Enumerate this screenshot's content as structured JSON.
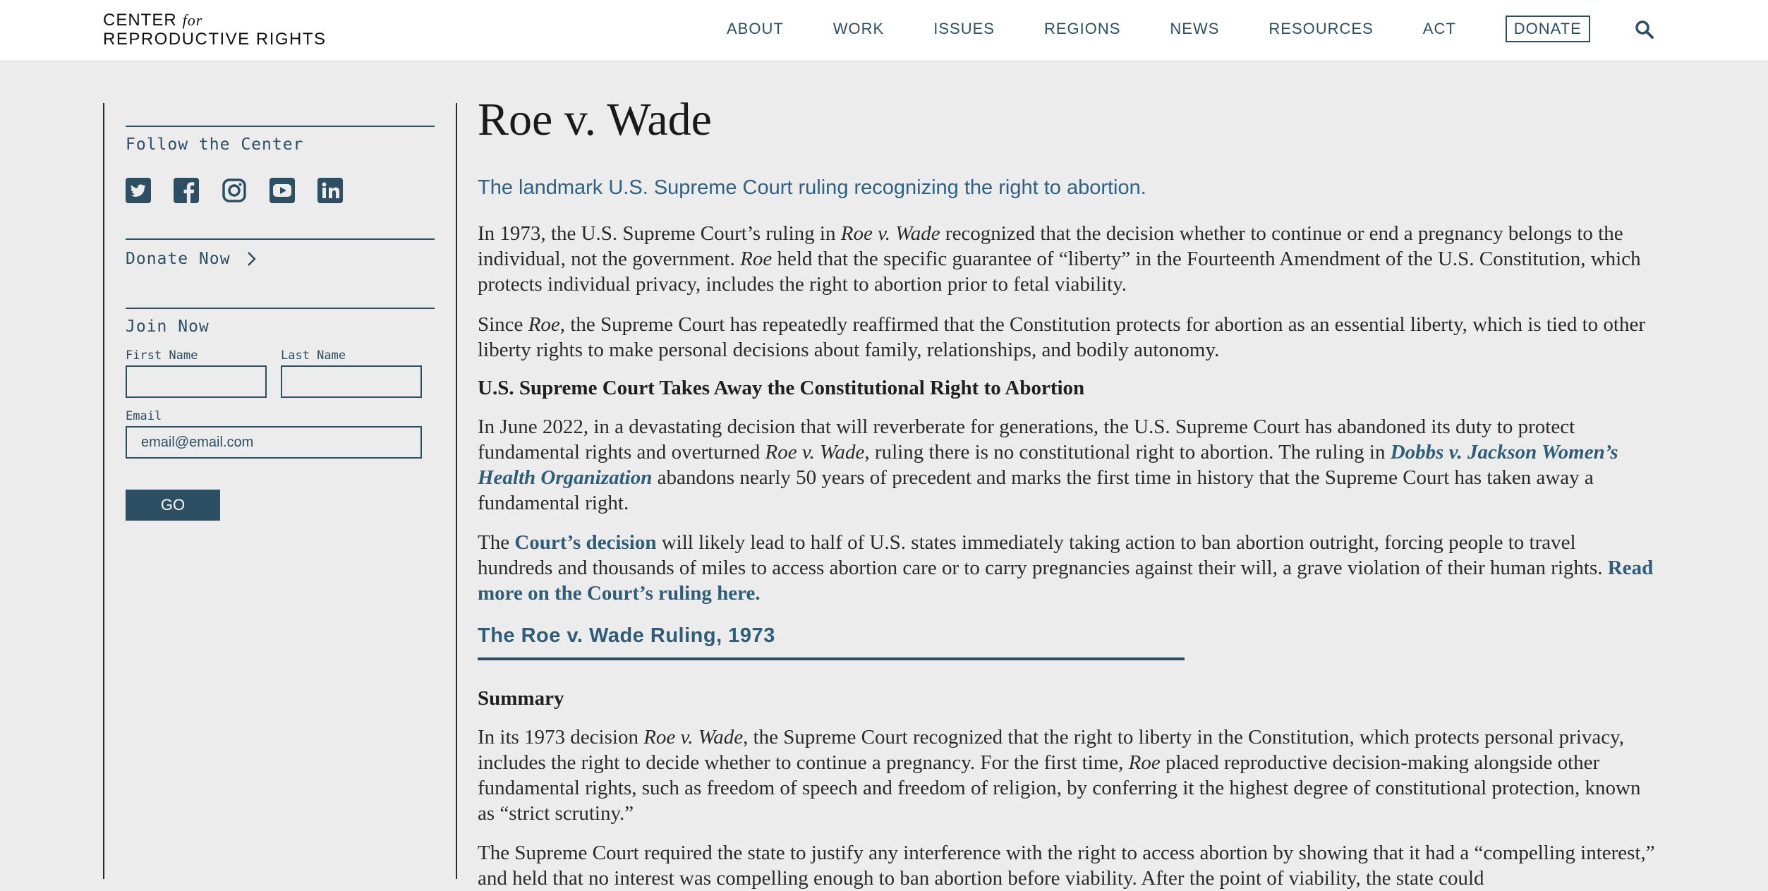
{
  "header": {
    "logo_line1": "CENTER",
    "logo_for": "for",
    "logo_line2": "REPRODUCTIVE RIGHTS",
    "nav": [
      "ABOUT",
      "WORK",
      "ISSUES",
      "REGIONS",
      "NEWS",
      "RESOURCES",
      "ACT"
    ],
    "donate_label": "DONATE",
    "search_icon": "search-icon"
  },
  "sidebar": {
    "follow_heading": "Follow the Center",
    "social_icons": [
      "twitter-icon",
      "facebook-icon",
      "instagram-icon",
      "youtube-icon",
      "linkedin-icon"
    ],
    "donate_now": "Donate Now",
    "join_heading": "Join Now",
    "first_name_label": "First Name",
    "last_name_label": "Last Name",
    "email_label": "Email",
    "email_placeholder": "email@email.com",
    "go_label": "GO"
  },
  "main": {
    "title": "Roe v. Wade",
    "subtitle": "The landmark U.S. Supreme Court ruling recognizing the right to abortion.",
    "p1": {
      "a": "In 1973, the U.S. Supreme Court’s ruling in ",
      "b": "Roe v. Wade",
      "c": " recognized that the decision whether to continue or end a pregnancy belongs to the individual, not the government. ",
      "d": "Roe",
      "e": " held that the specific guarantee of “liberty” in the Fourteenth Amendment of the U.S. Constitution, which protects individual privacy, includes the right to abortion prior to fetal viability."
    },
    "p2": {
      "a": "Since ",
      "b": "Roe",
      "c": ", the Supreme Court has repeatedly reaffirmed that the Constitution protects for abortion as an essential liberty, which is tied to other liberty rights to make personal decisions about family, relationships, and bodily autonomy."
    },
    "h_takes": "U.S. Supreme Court Takes Away the Constitutional Right to Abortion",
    "p3": {
      "a": "In June 2022, in a devastating decision that will reverberate for generations, the U.S. Supreme Court has abandoned its duty to protect fundamental rights and overturned ",
      "b": "Roe v. Wade",
      "c": ", ruling there is no constitutional right to abortion. The ruling in ",
      "link": "Dobbs v. Jackson Women’s Health Organization",
      "d": " abandons nearly 50 years of precedent and marks the first time in history that the Supreme Court has taken away a fundamental right."
    },
    "p4": {
      "a": "The ",
      "link1": "Court’s decision",
      "b": " will likely lead to half of U.S. states immediately taking action to ban abortion outright, forcing people to travel hundreds and thousands of miles to access abortion care or to carry pregnancies against their will, a grave violation of their human rights. ",
      "link2": "Read more on the Court’s ruling here."
    },
    "tab_title": "The Roe v. Wade Ruling, 1973",
    "h_summary": "Summary",
    "p5": {
      "a": "In its 1973 decision ",
      "b": "Roe v. Wade",
      "c": ", the Supreme Court recognized that the right to liberty in the Constitution, which protects personal privacy, includes the right to decide whether to continue a pregnancy. For the first time, ",
      "d": "Roe",
      "e": " placed reproductive decision-making alongside other fundamental rights, such as freedom of speech and freedom of religion, by conferring it the highest degree of constitutional protection, known as “strict scrutiny.”"
    },
    "p6": "The Supreme Court required the state to justify any interference with the right to access abortion by showing that it had a “compelling interest,” and held that no interest was compelling enough to ban abortion before viability. After the point of viability, the state could"
  },
  "colors": {
    "accent": "#2d4f63",
    "link": "#2d5d78",
    "background": "#ececec"
  }
}
